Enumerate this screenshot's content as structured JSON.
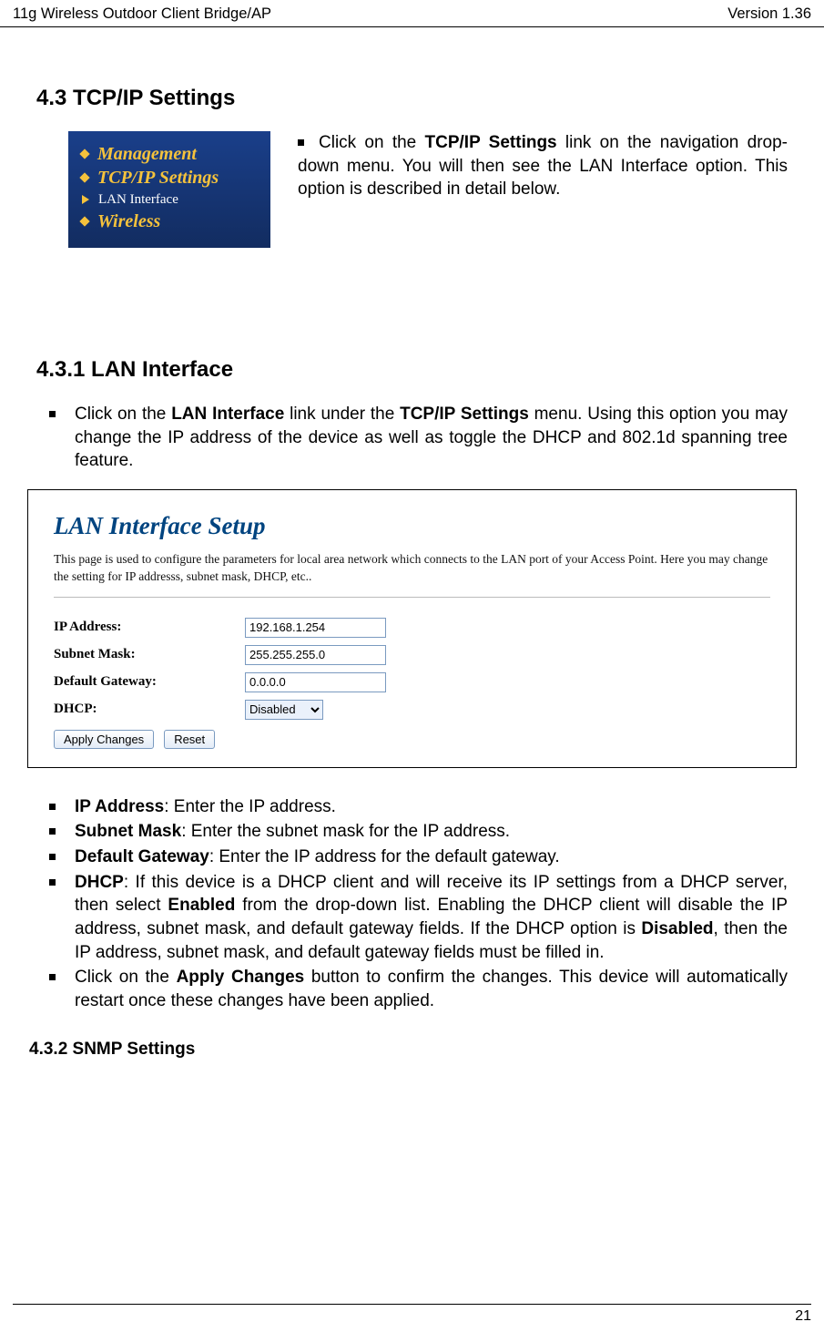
{
  "header": {
    "left": "11g Wireless Outdoor Client Bridge/AP",
    "right": "Version 1.36"
  },
  "section_4_3": {
    "heading": "4.3   TCP/IP Settings",
    "nav": {
      "management": "Management",
      "tcpip": "TCP/IP Settings",
      "lan": "LAN Interface",
      "wireless": "Wireless"
    },
    "intro_pre": "Click on the ",
    "intro_bold": "TCP/IP Settings",
    "intro_post": " link on the navigation drop-down menu. You will then see the LAN Interface option. This option is described in detail below."
  },
  "section_4_3_1": {
    "heading": "4.3.1  LAN Interface",
    "para_pre": "Click on the ",
    "para_b1": "LAN Interface",
    "para_mid": " link under the ",
    "para_b2": "TCP/IP Settings",
    "para_post": " menu. Using this option you may change the IP address of the device as well as toggle the DHCP and 802.1d spanning tree feature."
  },
  "lan_setup": {
    "title": "LAN Interface Setup",
    "desc": "This page is used to configure the parameters for local area network which connects to the LAN port of your Access Point. Here you may change the setting for IP addresss, subnet mask, DHCP, etc..",
    "labels": {
      "ip": "IP Address:",
      "mask": "Subnet Mask:",
      "gw": "Default Gateway:",
      "dhcp": "DHCP:"
    },
    "values": {
      "ip": "192.168.1.254",
      "mask": "255.255.255.0",
      "gw": "0.0.0.0",
      "dhcp": "Disabled"
    },
    "buttons": {
      "apply": "Apply Changes",
      "reset": "Reset"
    }
  },
  "bullets": {
    "ip_b": "IP Address",
    "ip_t": ": Enter the IP address.",
    "mask_b": "Subnet Mask",
    "mask_t": ": Enter the subnet mask for the IP address.",
    "gw_b": "Default Gateway",
    "gw_t": ": Enter the IP address for the default gateway.",
    "dhcp_b": "DHCP",
    "dhcp_t1": ": If this device is a DHCP client and will receive its IP settings from a DHCP server, then select ",
    "dhcp_en": "Enabled",
    "dhcp_t2": " from the drop-down list. Enabling the DHCP client will disable the IP address, subnet mask, and default gateway fields. If the DHCP option is ",
    "dhcp_dis": "Disabled",
    "dhcp_t3": ", then the IP address, subnet mask, and default gateway fields must be filled in.",
    "apply_t1": "Click on the ",
    "apply_b": "Apply Changes",
    "apply_t2": " button to confirm the changes. This device will automatically restart once these changes have been applied."
  },
  "section_4_3_2": {
    "heading": "4.3.2 SNMP Settings"
  },
  "footer": {
    "page": "21"
  }
}
